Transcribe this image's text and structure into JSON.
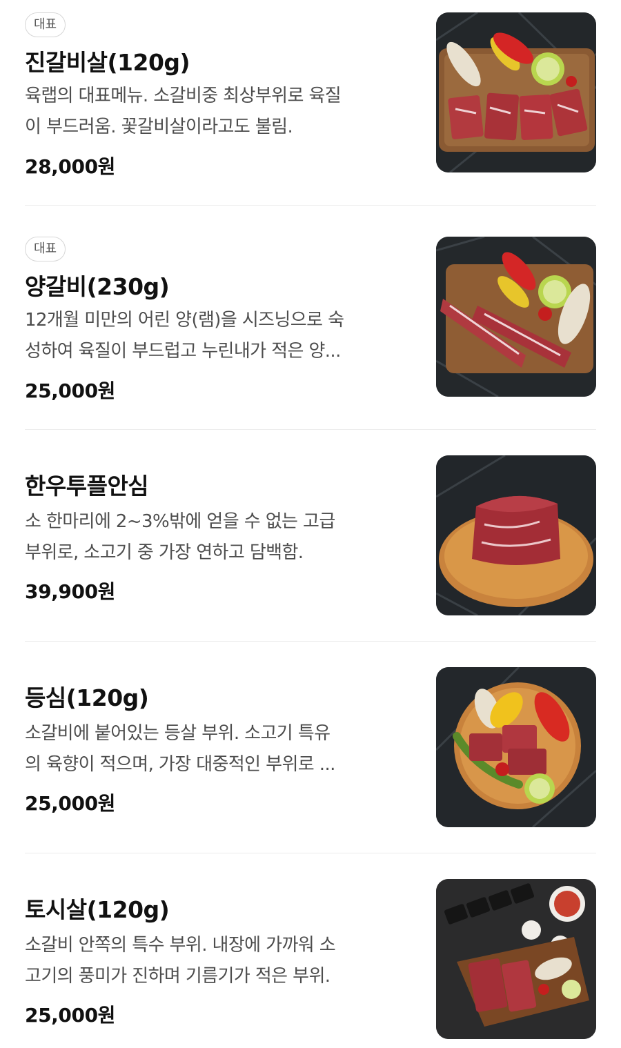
{
  "items": [
    {
      "badge": "대표",
      "name": "진갈비살(120g)",
      "desc_lines": [
        "육랩의 대표메뉴. 소갈비중 최상부위로 육질",
        "이 부드러움. 꽃갈비살이라고도 불림."
      ],
      "price": "28,000원",
      "image": "steak-vegetables-board-photo"
    },
    {
      "badge": "대표",
      "name": "양갈비(230g)",
      "desc_lines": [
        "12개월 미만의 어린 양(램)을 시즈닝으로 숙",
        "성하여 육질이 부드럽고 누린내가 적은 양..."
      ],
      "price": "25,000원",
      "image": "lamb-ribs-board-photo"
    },
    {
      "badge": "",
      "name": "한우투플안심",
      "desc_lines": [
        "소 한마리에 2~3%밖에 얻을 수 없는 고급",
        "부위로, 소고기 중 가장 연하고 담백함."
      ],
      "price": "39,900원",
      "image": "tenderloin-block-photo"
    },
    {
      "badge": "",
      "name": "등심(120g)",
      "desc_lines": [
        "소갈비에 붙어있는 등살 부위. 소고기 특유",
        "의 육향이 적으며, 가장 대중적인 부위로 ..."
      ],
      "price": "25,000원",
      "image": "sirloin-cubes-photo"
    },
    {
      "badge": "",
      "name": "토시살(120g)",
      "desc_lines": [
        "소갈비 안쪽의 특수 부위. 내장에 가까워 소",
        "고기의 풍미가 진하며 기름기가 적은 부위."
      ],
      "price": "25,000원",
      "image": "hanger-steak-platter-photo"
    }
  ],
  "colors": {
    "text_primary": "#111111",
    "text_secondary": "#4d4d4d",
    "badge_border": "#d6d6d6",
    "divider": "#ececec",
    "photo_background": "#1f2326"
  }
}
